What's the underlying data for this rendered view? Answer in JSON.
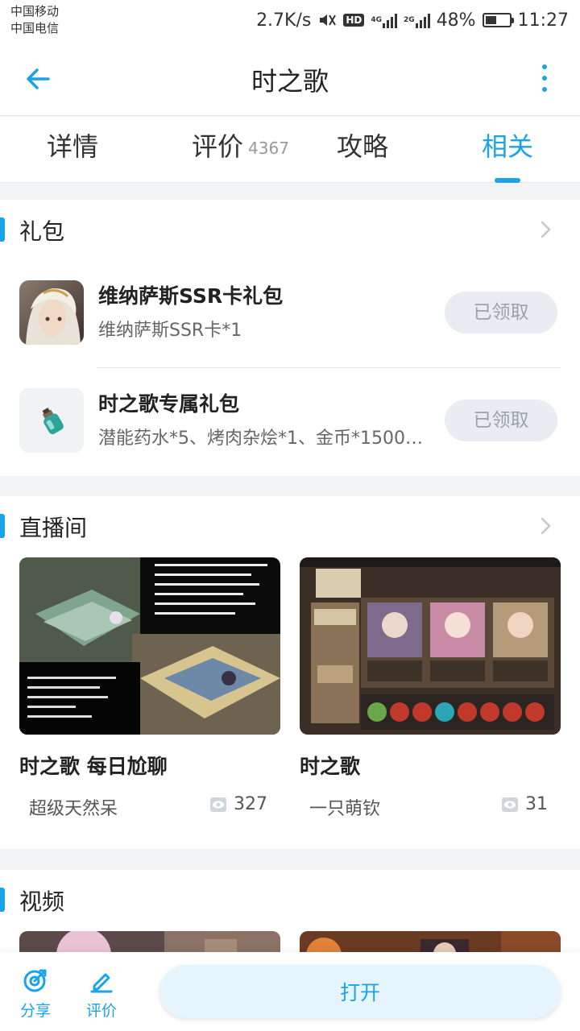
{
  "status_bar": {
    "carrier_1": "中国移动",
    "carrier_2": "中国电信",
    "network_speed": "2.7K/s",
    "hd_badge": "HD",
    "net_4g": "4G",
    "net_2g": "2G",
    "battery": "48%",
    "battery_level": 0.48,
    "time": "11:27"
  },
  "header": {
    "title": "时之歌"
  },
  "tabs": [
    {
      "label": "详情",
      "count": ""
    },
    {
      "label": "评价",
      "count": "4367"
    },
    {
      "label": "攻略",
      "count": ""
    },
    {
      "label": "相关",
      "count": "",
      "active": true
    }
  ],
  "gifts": {
    "section_title": "礼包",
    "items": [
      {
        "name": "维纳萨斯SSR卡礼包",
        "desc": "维纳萨斯SSR卡*1",
        "button": "已领取"
      },
      {
        "name": "时之歌专属礼包",
        "desc": "潜能药水*5、烤肉杂烩*1、金币*15000…",
        "button": "已领取"
      }
    ]
  },
  "live": {
    "section_title": "直播间",
    "items": [
      {
        "title": "时之歌 每日尬聊",
        "streamer": "超级天然呆",
        "views": "327"
      },
      {
        "title": "时之歌",
        "streamer": "一只萌钦",
        "views": "31"
      }
    ]
  },
  "video": {
    "section_title": "视频"
  },
  "bottom_bar": {
    "share_label": "分享",
    "review_label": "评价",
    "open_label": "打开"
  },
  "colors": {
    "accent": "#1aa3e8",
    "claimed_button_bg": "#e9ecf0",
    "open_button_bg": "#e5f4fd"
  }
}
